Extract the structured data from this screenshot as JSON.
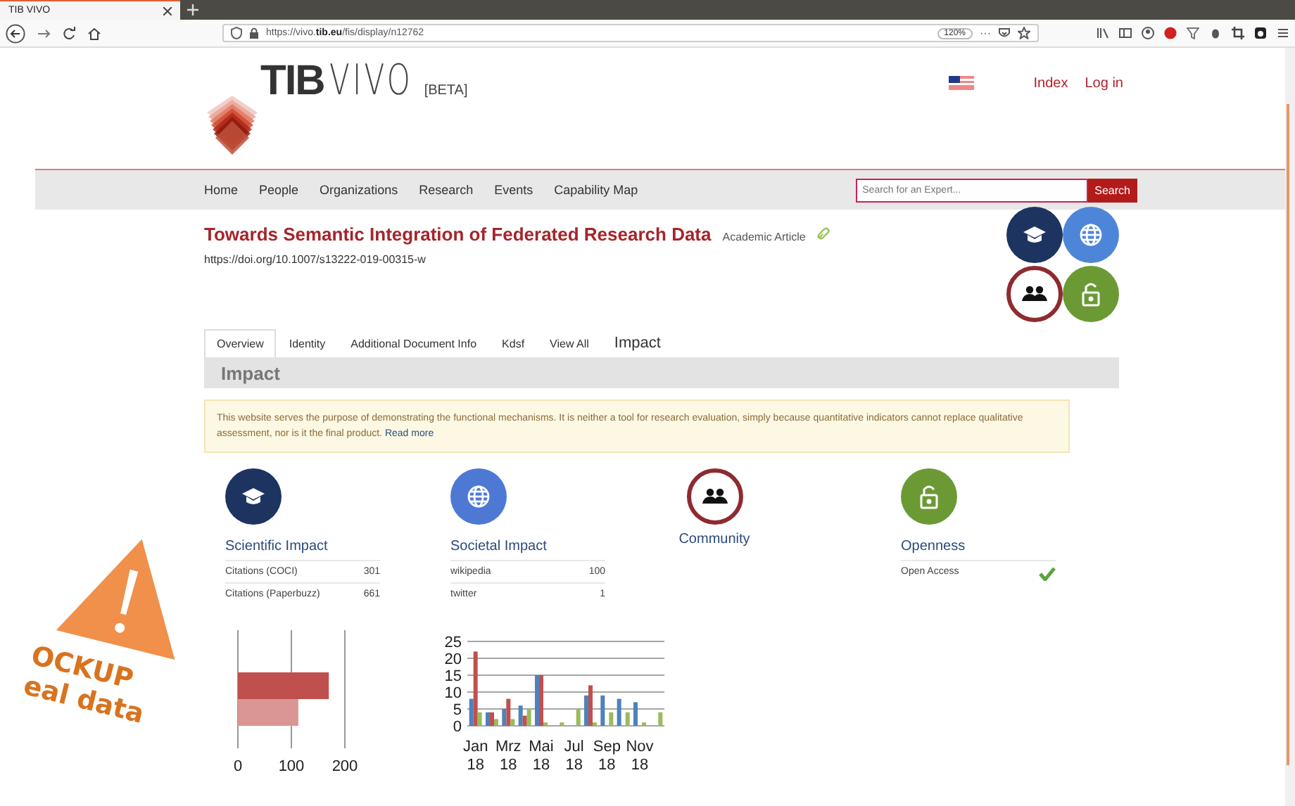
{
  "browser": {
    "tabs": [
      {
        "title": "TIB VIVO",
        "selected": true
      }
    ],
    "url": "https://vivo.**tib.eu**/fis/display/n12762",
    "zoom": "120%",
    "more": "···"
  },
  "site": {
    "logo": {
      "name": "TIB",
      "sub": "VIVO",
      "badge": "[BETA]"
    },
    "header_links": [
      "Index",
      "Log in"
    ],
    "nav": [
      "Home",
      "People",
      "Organizations",
      "Research",
      "Events",
      "Capability Map"
    ],
    "search": {
      "placeholder": "Search for an Expert...",
      "button": "Search"
    }
  },
  "article": {
    "title": "Towards Semantic Integration of Federated Research Data",
    "type": "Academic Article",
    "doi": "https://doi.org/10.1007/s13222-019-00315-w"
  },
  "impact_badges": [
    {
      "kind": "scientific",
      "color": "#1d3461",
      "outlined": false
    },
    {
      "kind": "societal",
      "color": "#4d86d9",
      "outlined": false
    },
    {
      "kind": "community",
      "color": "#8e2b30",
      "outlined": true
    },
    {
      "kind": "openness",
      "color": "#6b9a35",
      "outlined": false
    }
  ],
  "page_tabs": [
    {
      "label": "Overview",
      "selected": true,
      "large": false
    },
    {
      "label": "Identity",
      "selected": false,
      "large": false
    },
    {
      "label": "Additional Document Info",
      "selected": false,
      "large": false
    },
    {
      "label": "Kdsf",
      "selected": false,
      "large": false
    },
    {
      "label": "View All",
      "selected": false,
      "large": false
    },
    {
      "label": "Impact",
      "selected": false,
      "large": true
    }
  ],
  "panel": {
    "title": "Impact",
    "notice": "This website serves the purpose of demonstrating the functional mechanisms. It is neither a tool for research evaluation, simply because quantitative indicators cannot replace qualitative assessment, nor is it the final product.",
    "notice_link": "Read more"
  },
  "categories": [
    {
      "kind": "scientific",
      "color": "#1d3461",
      "outlined": false,
      "title": "Scientific Impact",
      "rows": [
        {
          "label": "Citations (COCI)",
          "value": "301"
        },
        {
          "label": "Citations (Paperbuzz)",
          "value": "661"
        }
      ]
    },
    {
      "kind": "societal",
      "color": "#4d79d4",
      "outlined": false,
      "title": "Societal Impact",
      "rows": [
        {
          "label": "wikipedia",
          "value": "100"
        },
        {
          "label": "twitter",
          "value": "1"
        }
      ]
    },
    {
      "kind": "community",
      "color": "#8e2b30",
      "outlined": true,
      "title": "Community"
    },
    {
      "kind": "openness",
      "color": "#6b9a35",
      "outlined": false,
      "title": "Openness",
      "rows": [
        {
          "label": "Open Access",
          "checked": true
        }
      ]
    }
  ],
  "charts": [
    {
      "chart_data": {
        "type": "bar",
        "orientation": "horizontal",
        "xlim": [
          0,
          200
        ],
        "xticks": [
          0,
          100,
          200
        ],
        "series": [
          {
            "color": "#c0504d",
            "values": [
              170
            ]
          },
          {
            "color": "#d99694",
            "values": [
              113
            ]
          }
        ]
      }
    },
    {
      "chart_data": {
        "type": "bar",
        "orientation": "vertical",
        "categories": [
          "Jan 18",
          null,
          "Mrz 18",
          null,
          "Mai 18",
          null,
          "Jul 18",
          null,
          "Sep 18",
          null,
          "Nov 18",
          null
        ],
        "ylim": [
          0,
          25
        ],
        "yticks": [
          0,
          5,
          10,
          15,
          20,
          25
        ],
        "grid": true,
        "series": [
          {
            "color": "#4f81bd",
            "values": [
              8,
              4,
              5,
              6,
              15,
              0,
              0,
              9,
              9,
              8,
              7,
              0
            ]
          },
          {
            "color": "#c0504d",
            "values": [
              22,
              4,
              8,
              3,
              15,
              0,
              0,
              12,
              0,
              0,
              0,
              0
            ]
          },
          {
            "color": "#9bbb59",
            "values": [
              4,
              2,
              2,
              5,
              1,
              1,
              5,
              1,
              4,
              4,
              1,
              4
            ]
          }
        ]
      }
    }
  ],
  "sticker": {
    "lines": [
      "OCKUP",
      "eal data"
    ]
  }
}
